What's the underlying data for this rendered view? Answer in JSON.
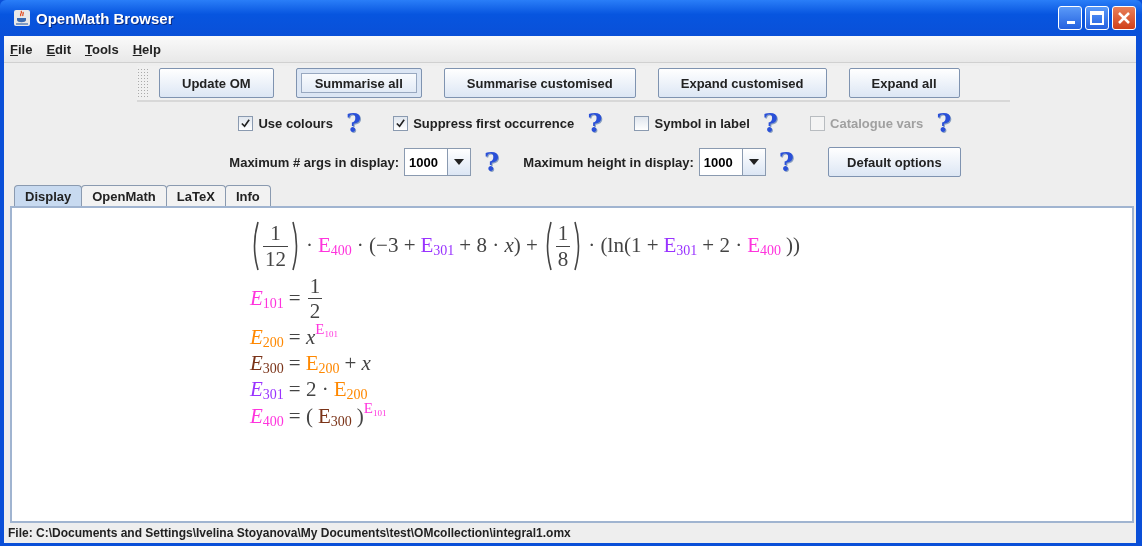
{
  "window": {
    "title": "OpenMath Browser"
  },
  "menu": [
    {
      "label": "File"
    },
    {
      "label": "Edit"
    },
    {
      "label": "Tools"
    },
    {
      "label": "Help"
    }
  ],
  "toolbar": [
    {
      "label": "Update OM",
      "focused": false
    },
    {
      "label": "Summarise all",
      "focused": true
    },
    {
      "label": "Summarise customised",
      "focused": false
    },
    {
      "label": "Expand customised",
      "focused": false
    },
    {
      "label": "Expand all",
      "focused": false
    }
  ],
  "options": [
    {
      "label": "Use colours",
      "checked": true,
      "disabled": false,
      "help": "?"
    },
    {
      "label": "Suppress first occurrence",
      "checked": true,
      "disabled": false,
      "help": "?"
    },
    {
      "label": "Symbol in label",
      "checked": false,
      "disabled": false,
      "help": "?"
    },
    {
      "label": "Catalogue vars",
      "checked": false,
      "disabled": true,
      "help": "?"
    }
  ],
  "limits": [
    {
      "label": "Maximum # args in display:",
      "value": "1000",
      "help": "?"
    },
    {
      "label": "Maximum height in display:",
      "value": "1000",
      "help": "?"
    }
  ],
  "default_button": "Default options",
  "tabs": [
    {
      "label": "Display",
      "selected": true
    },
    {
      "label": "OpenMath",
      "selected": false
    },
    {
      "label": "LaTeX",
      "selected": false
    },
    {
      "label": "Info",
      "selected": false
    }
  ],
  "display": {
    "lines": [
      [
        {
          "kind": "frac",
          "num": "1",
          "den": "12",
          "parens": true
        },
        {
          "kind": "text",
          "text": "·"
        },
        {
          "kind": "var",
          "base": "E",
          "sub": "400",
          "color": "#ff33dd",
          "italic": false
        },
        {
          "kind": "text",
          "text": "· (−3 +"
        },
        {
          "kind": "var",
          "base": "E",
          "sub": "301",
          "color": "#9933ff",
          "italic": false
        },
        {
          "kind": "text",
          "text": "+ 8 · *x*) +"
        },
        {
          "kind": "frac",
          "num": "1",
          "den": "8",
          "parens": true
        },
        {
          "kind": "text",
          "text": "· (ln(1 +"
        },
        {
          "kind": "var",
          "base": "E",
          "sub": "301",
          "color": "#9933ff",
          "italic": false
        },
        {
          "kind": "text",
          "text": "+ 2 ·"
        },
        {
          "kind": "var",
          "base": "E",
          "sub": "400",
          "color": "#ff33dd",
          "italic": false
        },
        {
          "kind": "text",
          "text": "))"
        }
      ],
      [
        {
          "kind": "var",
          "base": "E",
          "sub": "101",
          "color": "#ff33dd",
          "italic": true
        },
        {
          "kind": "text",
          "text": "="
        },
        {
          "kind": "frac",
          "num": "1",
          "den": "2",
          "parens": false
        }
      ],
      [
        {
          "kind": "var",
          "base": "E",
          "sub": "200",
          "color": "#ff8800",
          "italic": true
        },
        {
          "kind": "text",
          "text": "= *x*"
        },
        {
          "kind": "sup",
          "base": "E",
          "sub": "101",
          "color": "#ff33dd",
          "italic": false
        }
      ],
      [
        {
          "kind": "var",
          "base": "E",
          "sub": "300",
          "color": "#7a3318",
          "italic": true
        },
        {
          "kind": "text",
          "text": "="
        },
        {
          "kind": "var",
          "base": "E",
          "sub": "200",
          "color": "#ff8800",
          "italic": false
        },
        {
          "kind": "text",
          "text": "+ *x*"
        }
      ],
      [
        {
          "kind": "var",
          "base": "E",
          "sub": "301",
          "color": "#9933ff",
          "italic": true
        },
        {
          "kind": "text",
          "text": "= 2 ·"
        },
        {
          "kind": "var",
          "base": "E",
          "sub": "200",
          "color": "#ff8800",
          "italic": false
        }
      ],
      [
        {
          "kind": "var",
          "base": "E",
          "sub": "400",
          "color": "#ff33dd",
          "italic": true
        },
        {
          "kind": "text",
          "text": "= ("
        },
        {
          "kind": "var",
          "base": "E",
          "sub": "300",
          "color": "#7a3318",
          "italic": false
        },
        {
          "kind": "text",
          "text": ")"
        },
        {
          "kind": "sup",
          "base": "E",
          "sub": "101",
          "color": "#ff33dd",
          "italic": false
        }
      ]
    ]
  },
  "status_bar": "File: C:\\Documents and Settings\\Ivelina Stoyanova\\My Documents\\test\\OMcollection\\integral1.omx"
}
